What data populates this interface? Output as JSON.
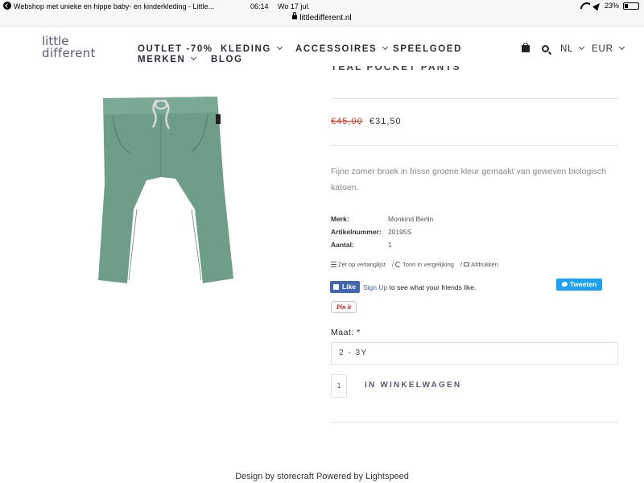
{
  "status": {
    "tab_title": "Webshop met unieke en hippe baby- en kinderkleding - Little...",
    "time": "06:14",
    "date": "Wo 17 jul.",
    "battery": "23%",
    "battery_level": 0.23
  },
  "url": "littledifferent.nl",
  "logo": {
    "line1": "little",
    "line2": "different"
  },
  "nav": {
    "outlet": "OUTLET -70%",
    "kleding": "KLEDING",
    "accessoires": "ACCESSOIRES",
    "speelgoed": "SPEELGOED",
    "merken": "MERKEN",
    "blog": "BLOG"
  },
  "header_right": {
    "language": "NL",
    "currency": "EUR"
  },
  "product": {
    "title": "TEAL POCKET PANTS",
    "price_old": "€45,00",
    "price_new": "€31,50",
    "description": "Fijne zomer broek in frisse groene kleur gemaakt van geweven biologisch katoen.",
    "specs": {
      "merk_label": "Merk:",
      "merk": "Monkind Berlin",
      "artikel_label": "Artikelnummer:",
      "artikel": "20195S",
      "aantal_label": "Aantal:",
      "aantal": "1"
    },
    "actions": {
      "wishlist": "Zet op verlanglijst",
      "compare": "Toon in vergelijking",
      "print": "Afdrukken"
    },
    "image_color": "#6e9e8a"
  },
  "social": {
    "like": "Like",
    "signup": "Sign Up",
    "signup_rest": "to see what your friends like.",
    "tweet": "Tweeten",
    "pin": "Pin it"
  },
  "options": {
    "maat_label": "Maat: *",
    "maat_value": "2 - 3Y",
    "quantity": "1",
    "cart_button": "IN WINKELWAGEN"
  },
  "footer": "Design by storecraft Powered by Lightspeed",
  "colors": {
    "brand": "#5e5876",
    "sale": "#e0301e",
    "facebook": "#4267b2",
    "twitter": "#1da1f2"
  }
}
